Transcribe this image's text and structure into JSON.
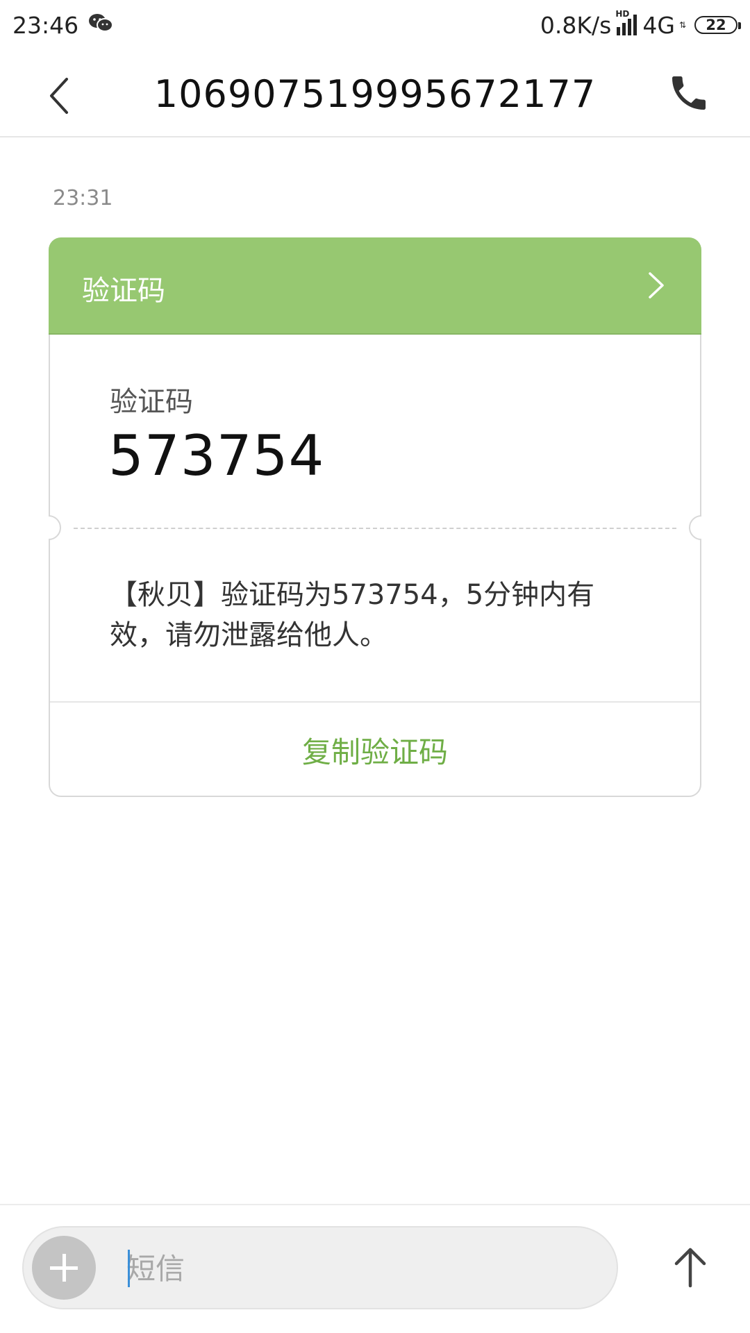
{
  "status_bar": {
    "time": "23:46",
    "app_icon": "wechat-icon",
    "net_speed": "0.8K/s",
    "signal_label": "HD",
    "network": "4G",
    "battery": "22"
  },
  "header": {
    "title": "106907519995672177",
    "back_icon": "back-chevron-icon",
    "call_icon": "phone-icon"
  },
  "conversation": {
    "timestamp": "23:31",
    "card": {
      "header_title": "验证码",
      "header_color": "#97c871",
      "code_label": "验证码",
      "code_value": "573754",
      "message_text": "【秋贝】验证码为573754，5分钟内有效，请勿泄露给他人。",
      "copy_button": "复制验证码",
      "copy_color": "#6fae46"
    }
  },
  "composer": {
    "placeholder": "短信",
    "add_icon": "plus-icon",
    "send_icon": "arrow-up-icon"
  }
}
